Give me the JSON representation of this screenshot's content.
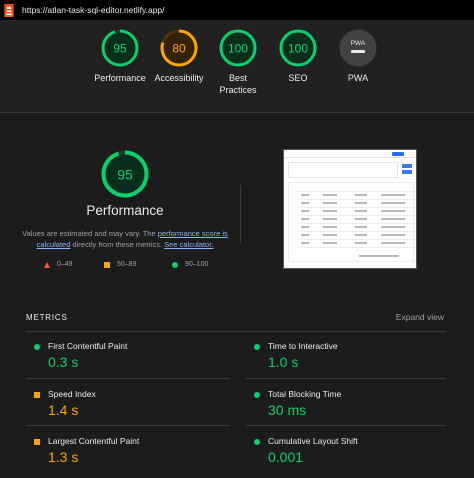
{
  "address_bar": {
    "url": "https://atlan-task-sql-editor.netlify.app/"
  },
  "colors": {
    "pass": "#0cce6b",
    "average": "#ffa400",
    "fail": "#ff4e42",
    "link": "#8ab4f8"
  },
  "top_scores": [
    {
      "score": "95",
      "label": "Performance",
      "level": "pass",
      "fraction": 0.95
    },
    {
      "score": "80",
      "label": "Accessibility",
      "level": "average",
      "fraction": 0.8
    },
    {
      "score": "100",
      "label": "Best Practices",
      "level": "pass",
      "fraction": 1.0
    },
    {
      "score": "100",
      "label": "SEO",
      "level": "pass",
      "fraction": 1.0
    },
    {
      "score": "PWA",
      "label": "PWA",
      "level": "neutral",
      "fraction": 0
    }
  ],
  "performance": {
    "score": "95",
    "fraction": 0.95,
    "title": "Performance",
    "desc_before": "Values are estimated and may vary. The ",
    "desc_link1": "performance score is calculated",
    "desc_middle": " directly from these metrics. ",
    "desc_link2": "See calculator.",
    "legend": {
      "fail": "0–49",
      "average": "50–89",
      "pass": "90–100"
    }
  },
  "metrics": {
    "heading": "METRICS",
    "expand": "Expand view",
    "items": [
      {
        "name": "First Contentful Paint",
        "value": "0.3 s",
        "level": "pass"
      },
      {
        "name": "Time to Interactive",
        "value": "1.0 s",
        "level": "pass"
      },
      {
        "name": "Speed Index",
        "value": "1.4 s",
        "level": "average"
      },
      {
        "name": "Total Blocking Time",
        "value": "30 ms",
        "level": "pass"
      },
      {
        "name": "Largest Contentful Paint",
        "value": "1.3 s",
        "level": "average"
      },
      {
        "name": "Cumulative Layout Shift",
        "value": "0.001",
        "level": "pass"
      }
    ]
  }
}
